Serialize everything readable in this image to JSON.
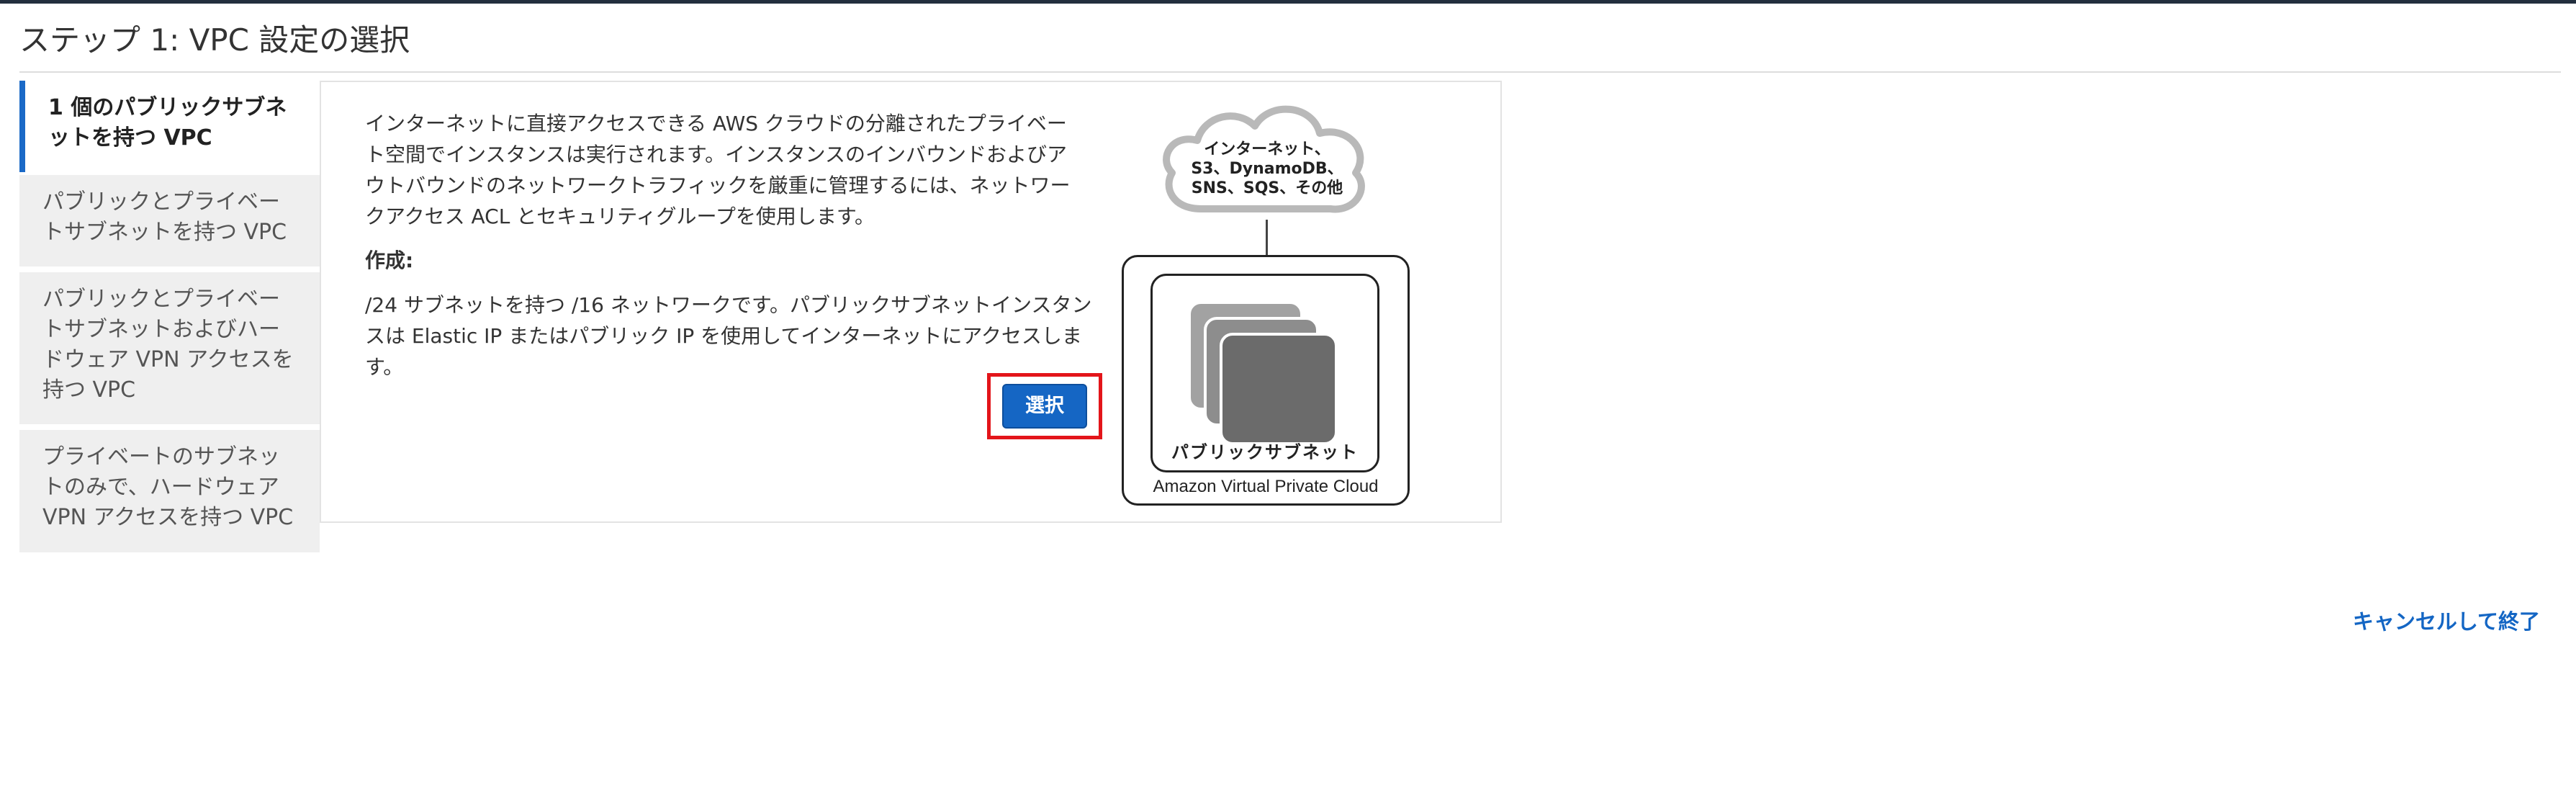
{
  "page": {
    "title": "ステップ 1: VPC 設定の選択"
  },
  "tabs": [
    {
      "label": "1 個のパブリックサブネットを持つ VPC",
      "active": true
    },
    {
      "label": "パブリックとプライベートサブネットを持つ VPC",
      "active": false
    },
    {
      "label": "パブリックとプライベートサブネットおよびハードウェア VPN アクセスを持つ VPC",
      "active": false
    },
    {
      "label": "プライベートのサブネットのみで、ハードウェア VPN アクセスを持つ VPC",
      "active": false
    }
  ],
  "content": {
    "description": "インターネットに直接アクセスできる AWS クラウドの分離されたプライベート空間でインスタンスは実行されます。インスタンスのインバウンドおよびアウトバウンドのネットワークトラフィックを厳重に管理するには、ネットワークアクセス ACL とセキュリティグループを使用します。",
    "create_heading": "作成:",
    "create_description": "/24 サブネットを持つ /16 ネットワークです。パブリックサブネットインスタンスは Elastic IP またはパブリック IP を使用してインターネットにアクセスします。",
    "select_button": "選択"
  },
  "diagram": {
    "cloud_line1": "インターネット、",
    "cloud_line2": "S3、DynamoDB、",
    "cloud_line3": "SNS、SQS、その他",
    "subnet_label": "パブリックサブネット",
    "vpc_label": "Amazon Virtual Private Cloud"
  },
  "footer": {
    "cancel_link": "キャンセルして終了"
  },
  "colors": {
    "accent": "#1566c4",
    "highlight": "#e3151a",
    "tab_inactive_bg": "#efefef"
  }
}
